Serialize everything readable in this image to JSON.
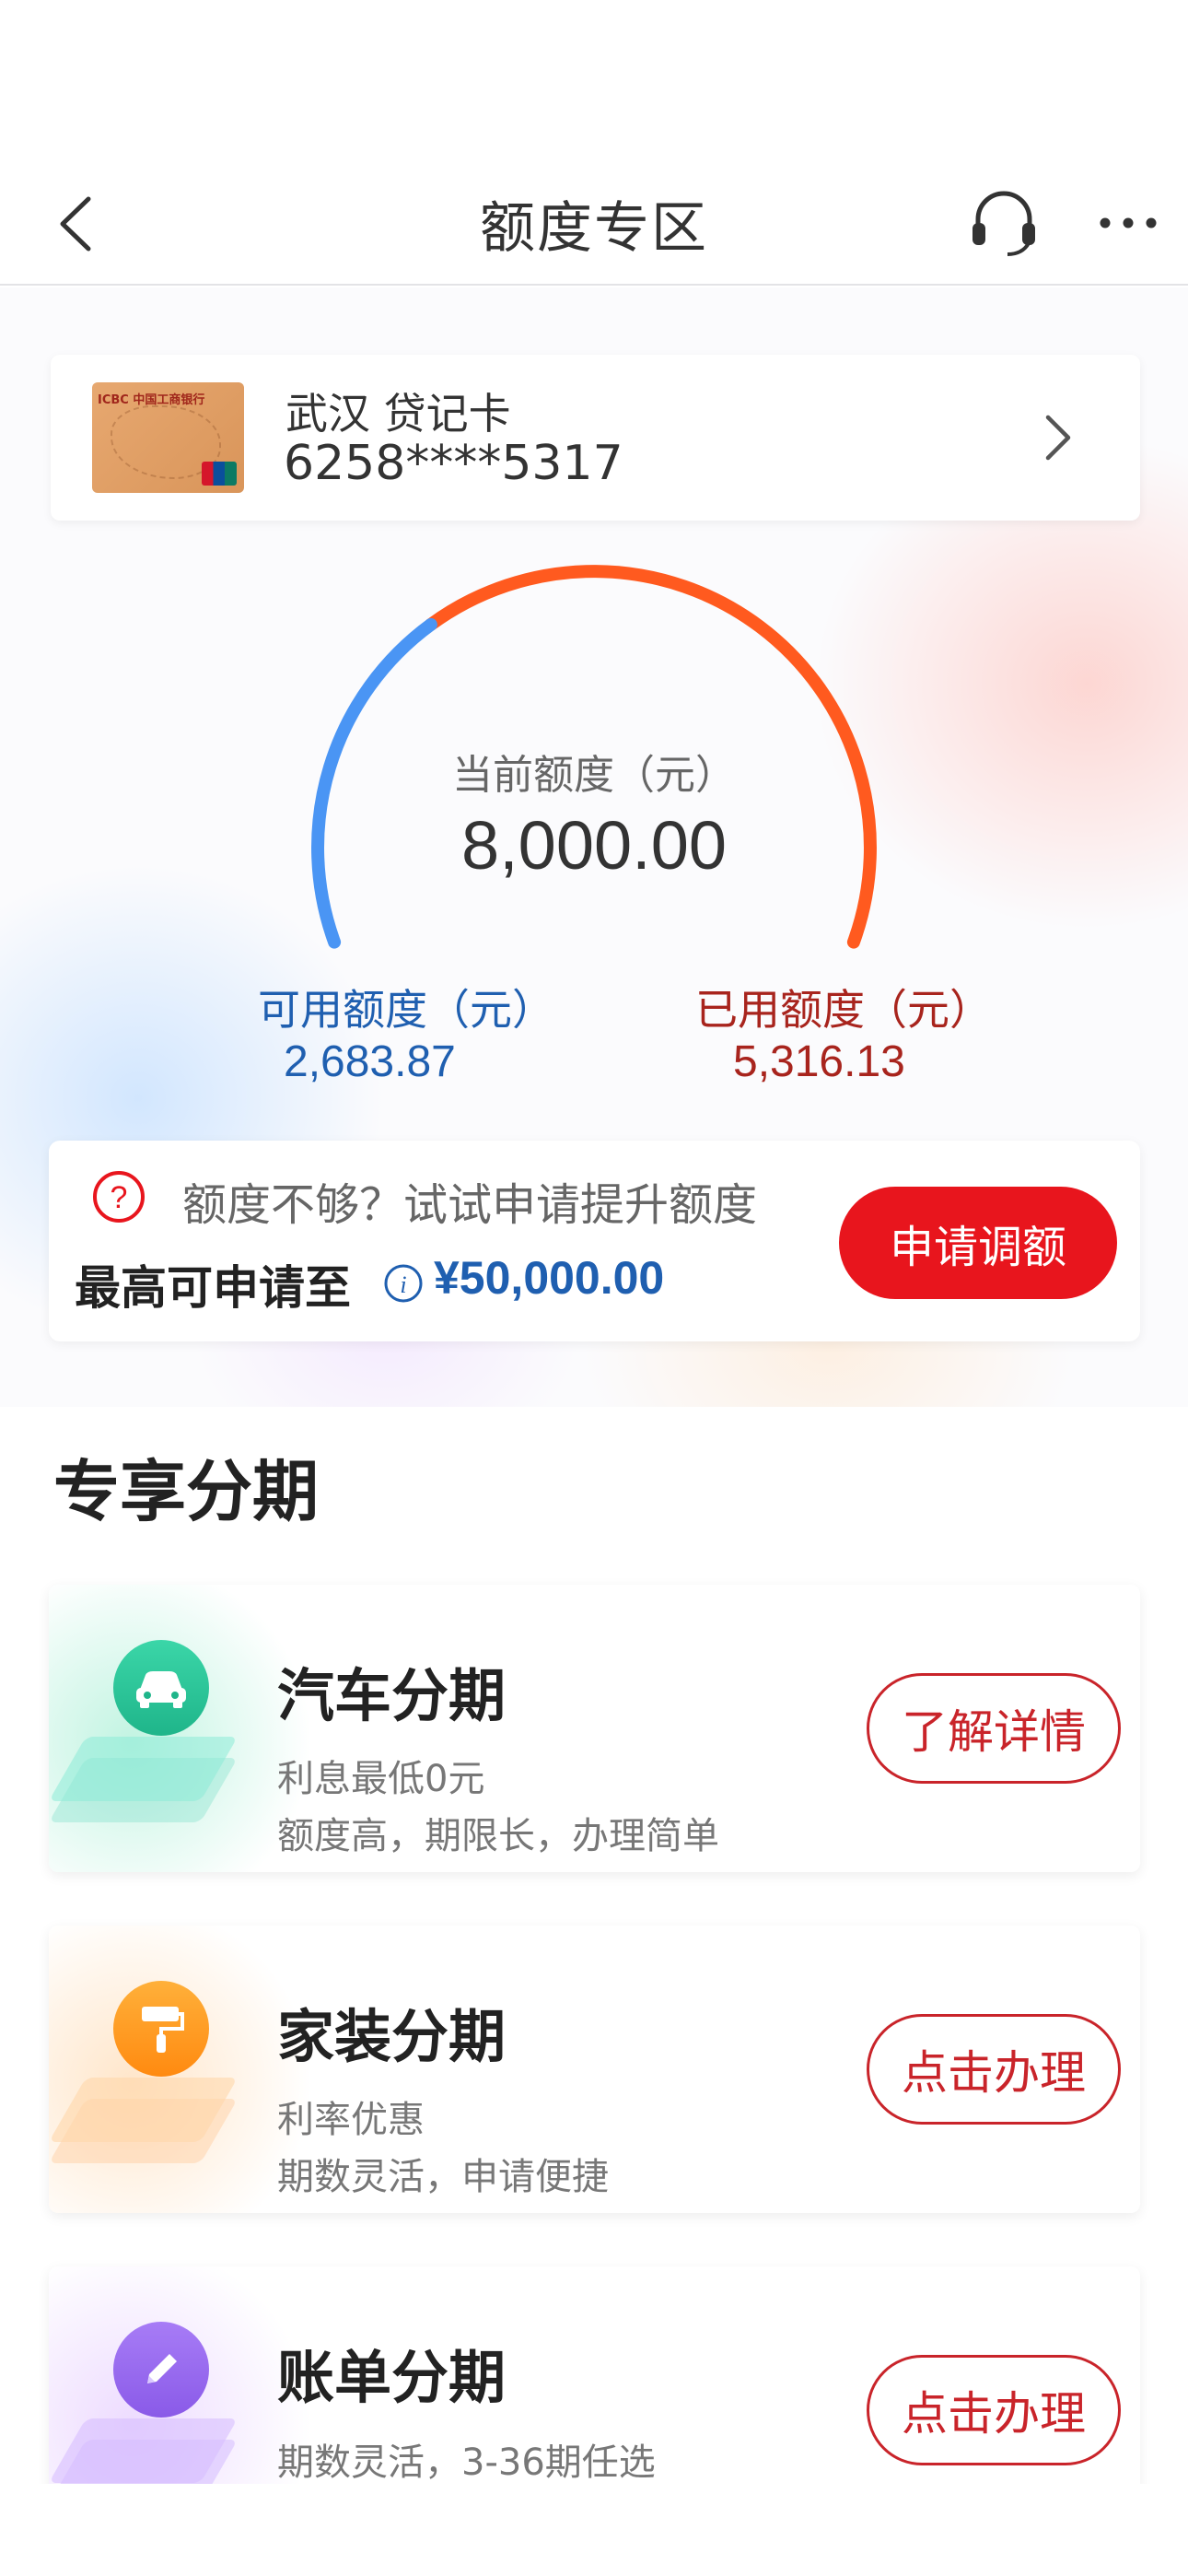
{
  "header": {
    "title": "额度专区"
  },
  "card": {
    "bank_text": "ICBC 中国工商银行",
    "name": "武汉 贷记卡",
    "number": "6258****5317"
  },
  "limit": {
    "current_label": "当前额度（元）",
    "current_value": "8,000.00",
    "available_label": "可用额度（元）",
    "available_value": "2,683.87",
    "used_label": "已用额度（元）",
    "used_value": "5,316.13",
    "used_fraction": 0.6645
  },
  "raise": {
    "tip": "额度不够？试试申请提升额度",
    "max_label": "最高可申请至",
    "max_value": "¥50,000.00",
    "button": "申请调额"
  },
  "installments": {
    "section_title": "专享分期",
    "items": [
      {
        "title": "汽车分期",
        "line1": "利息最低0元",
        "line2": "额度高，期限长，办理简单",
        "button": "了解详情",
        "icon": "car-icon",
        "color": "#2cc99a"
      },
      {
        "title": "家装分期",
        "line1": "利率优惠",
        "line2": "期数灵活，申请便捷",
        "button": "点击办理",
        "icon": "paint-roller-icon",
        "color": "#ff9a1f"
      },
      {
        "title": "账单分期",
        "line1": "期数灵活，3-36期任选",
        "line2": "",
        "button": "点击办理",
        "icon": "pencil-icon",
        "color": "#9b6bf0"
      }
    ]
  },
  "colors": {
    "accent_red": "#e8151d",
    "available_blue": "#1f5fb0",
    "used_red": "#a8241d",
    "gauge_blue": "#4a95f4",
    "gauge_orange": "#ff5a1f"
  }
}
